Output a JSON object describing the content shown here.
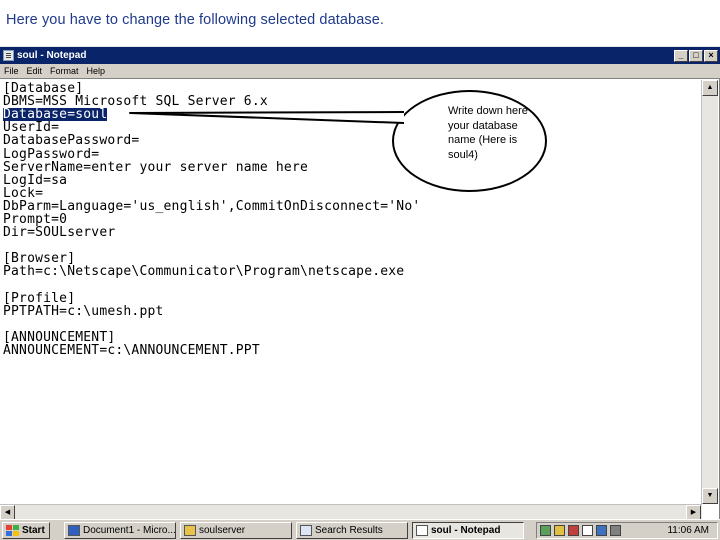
{
  "slide": {
    "caption": "Here you have to change the following selected database."
  },
  "window": {
    "title": "soul - Notepad",
    "caption_buttons": {
      "minimize": "_",
      "maximize": "□",
      "close": "×"
    }
  },
  "menu": {
    "items": [
      "File",
      "Edit",
      "Format",
      "Help"
    ]
  },
  "editor": {
    "lines": [
      "[Database]",
      "DBMS=MSS Microsoft SQL Server 6.x",
      "Database=soul",
      "UserId=",
      "DatabasePassword=",
      "LogPassword=",
      "ServerName=enter your server name here",
      "LogId=sa",
      "Lock=",
      "DbParm=Language='us_english',CommitOnDisconnect='No'",
      "Prompt=0",
      "Dir=SOULserver",
      "",
      "[Browser]",
      "Path=c:\\Netscape\\Communicator\\Program\\netscape.exe",
      "",
      "[Profile]",
      "PPTPATH=c:\\umesh.ppt",
      "",
      "[ANNOUNCEMENT]",
      "ANNOUNCEMENT=c:\\ANNOUNCEMENT.PPT"
    ],
    "selected_line_index": 2
  },
  "callout": {
    "text": "Write down here your database name (Here is soul4)"
  },
  "taskbar": {
    "start_label": "Start",
    "tasks": [
      {
        "label": "Document1 - Micro...",
        "icon": "word-document-icon",
        "active": false
      },
      {
        "label": "soulserver",
        "icon": "folder-icon",
        "active": false
      },
      {
        "label": "Search Results",
        "icon": "search-icon",
        "active": false
      },
      {
        "label": "soul - Notepad",
        "icon": "notepad-icon",
        "active": true
      }
    ],
    "clock": "11:06 AM"
  },
  "colors": {
    "titlebar": "#0a246a",
    "selection": "#0a246a",
    "caption_text": "#1f3a8a",
    "chrome": "#d4d0c8"
  }
}
